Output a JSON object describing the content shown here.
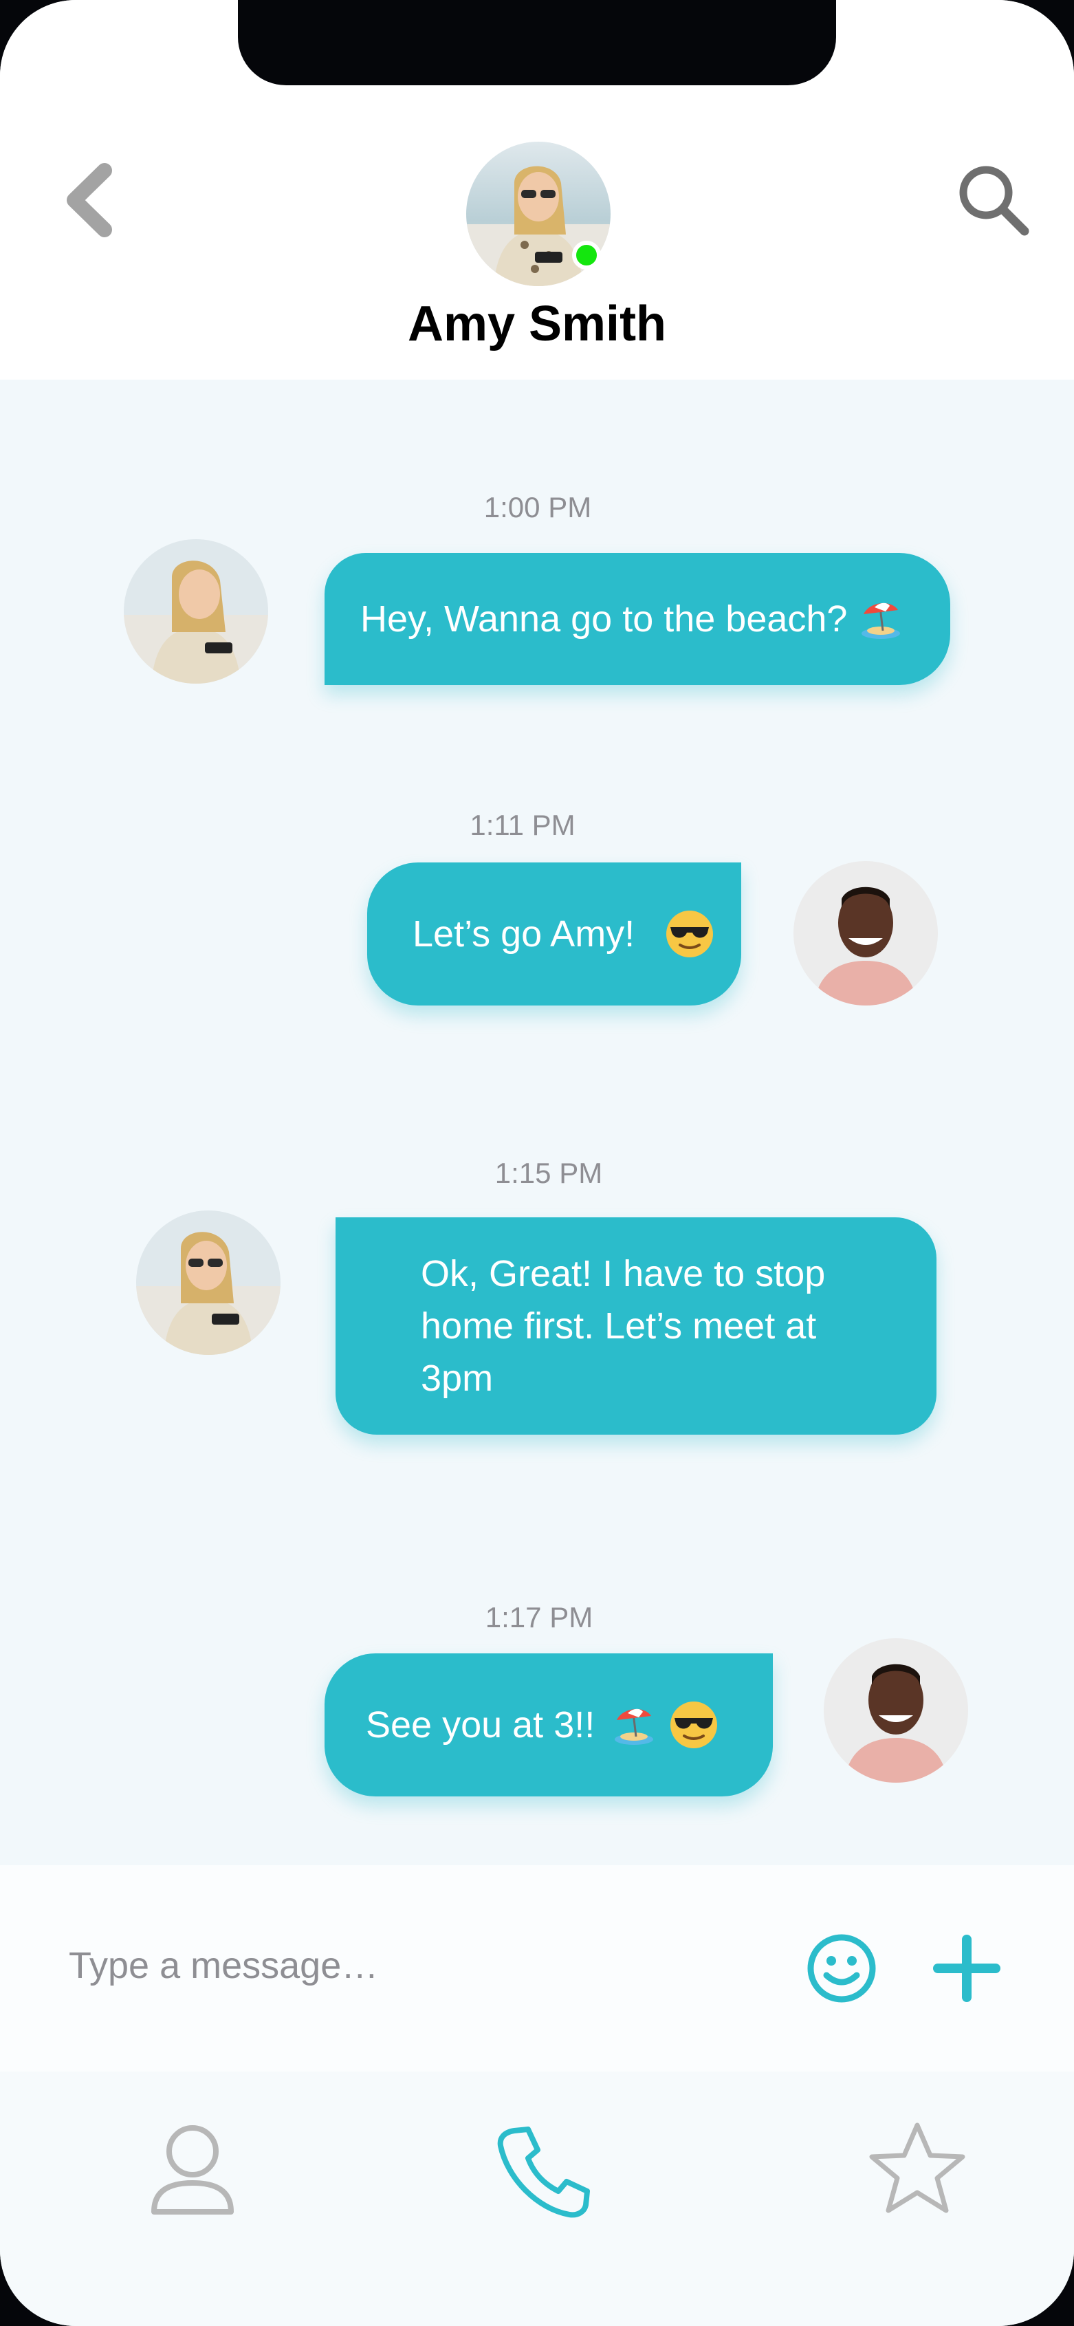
{
  "contact": {
    "name": "Amy Smith",
    "status_color": "#14e60e"
  },
  "header": {
    "back_icon": "chevron-left-icon",
    "search_icon": "search-icon"
  },
  "messages": [
    {
      "time": "1:00 PM",
      "text": "Hey, Wanna go to the beach?",
      "emoji": "beach-umbrella",
      "sender": "contact"
    },
    {
      "time": "1:11 PM",
      "text": "Let’s go Amy!",
      "emoji": "sunglasses-face",
      "sender": "me"
    },
    {
      "time": "1:15 PM",
      "text": "Ok, Great!  I have to stop home first. Let’s meet at 3pm",
      "sender": "contact"
    },
    {
      "time": "1:17 PM",
      "text": "See you at 3!!",
      "emoji": "beach-umbrella, sunglasses-face",
      "sender": "me"
    }
  ],
  "composer": {
    "placeholder": "Type a message…",
    "emoji_icon": "smiley-icon",
    "add_icon": "plus-icon"
  },
  "tabs": [
    {
      "name": "profile",
      "icon": "person-icon",
      "active": false
    },
    {
      "name": "calls",
      "icon": "phone-icon",
      "active": true
    },
    {
      "name": "favorites",
      "icon": "star-icon",
      "active": false
    }
  ],
  "colors": {
    "accent": "#2bbccb",
    "bubble_text": "#ffffff",
    "inactive_icon": "#b7b7b7",
    "time_text": "#8e8e93"
  }
}
